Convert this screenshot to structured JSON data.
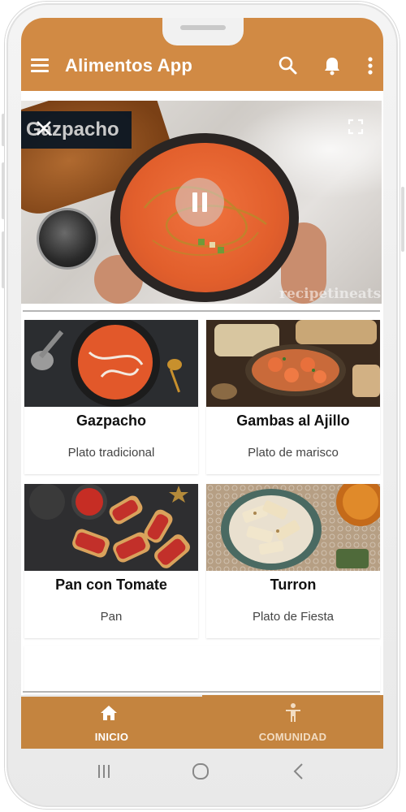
{
  "app": {
    "title": "Alimentos App"
  },
  "appbar_icons": [
    "menu-icon",
    "search-icon",
    "bell-icon",
    "more-vert-icon"
  ],
  "video": {
    "title": "Gazpacho",
    "watermark": "recipetineats",
    "state": "playing"
  },
  "cards": [
    {
      "name": "Gazpacho",
      "subtitle": "Plato tradicional"
    },
    {
      "name": "Gambas al Ajillo",
      "subtitle": "Plato de marisco"
    },
    {
      "name": "Pan con Tomate",
      "subtitle": "Pan"
    },
    {
      "name": "Turron",
      "subtitle": "Plato de Fiesta"
    }
  ],
  "bottom_nav": {
    "tabs": [
      {
        "label": "INICIO",
        "icon": "home-icon",
        "active": true
      },
      {
        "label": "COMUNIDAD",
        "icon": "person-icon",
        "active": false
      }
    ]
  },
  "colors": {
    "primary": "#d18a44",
    "bottom_nav": "#c4843f"
  }
}
